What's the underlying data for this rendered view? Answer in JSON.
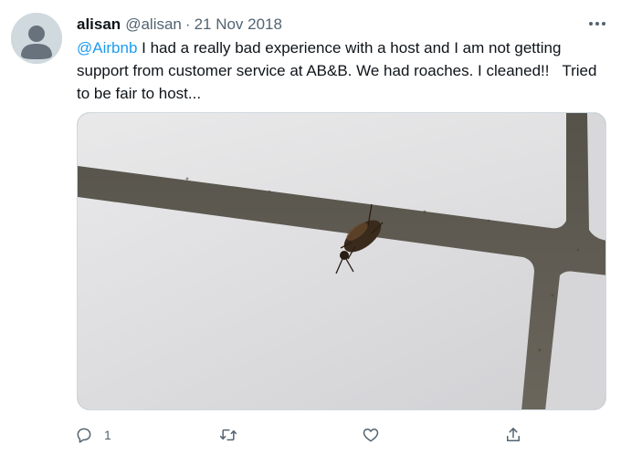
{
  "tweet": {
    "display_name": "alisan",
    "handle": "@alisan",
    "separator": "·",
    "date": "21 Nov 2018",
    "mention": "@Airbnb",
    "body": " I had a really bad experience with a host and I am not getting support from customer service at AB&B. We had roaches. I cleaned!!   Tried to be fair to host...",
    "media_icon": "photo-of-cockroach-on-tile"
  },
  "actions": {
    "reply_icon": "reply-icon",
    "reply_count": "1",
    "retweet_icon": "retweet-icon",
    "like_icon": "heart-icon",
    "share_icon": "share-icon",
    "more_icon": "more-icon"
  },
  "colors": {
    "text": "#0f1419",
    "secondary": "#536471",
    "accent": "#1d9bf0",
    "avatar_bg": "#cfd9de"
  }
}
